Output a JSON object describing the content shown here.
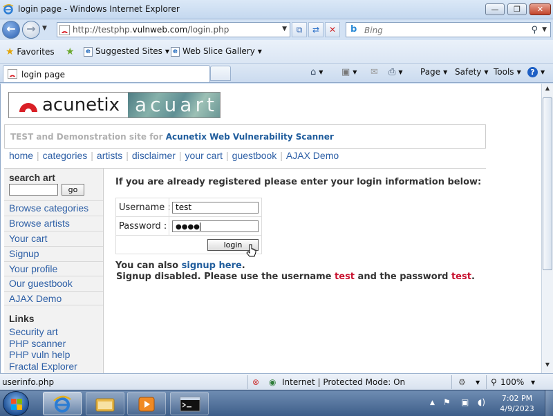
{
  "window": {
    "title": "login page - Windows Internet Explorer",
    "minimize": "—",
    "restore": "❐",
    "close": "✕"
  },
  "address_bar": {
    "url_prefix": "http://testphp.",
    "url_domain": "vulnweb.com",
    "url_path": "/login.php",
    "search_placeholder": "Bing"
  },
  "favorites_bar": {
    "favorites": "Favorites",
    "suggested_sites": "Suggested Sites",
    "web_slice_gallery": "Web Slice Gallery"
  },
  "tabs": {
    "active_tab": "login page",
    "page_menu": "Page",
    "safety_menu": "Safety",
    "tools_menu": "Tools",
    "help": "?"
  },
  "site": {
    "logo_text": "acunetix",
    "logo_art": "acuart",
    "tagline_prefix": "TEST and Demonstration site for ",
    "tagline_link": "Acunetix Web Vulnerability Scanner",
    "top_nav": [
      "home",
      "categories",
      "artists",
      "disclaimer",
      "your cart",
      "guestbook",
      "AJAX Demo"
    ]
  },
  "sidebar": {
    "search_heading": "search art",
    "search_button": "go",
    "nav": [
      "Browse categories",
      "Browse artists",
      "Your cart",
      "Signup",
      "Your profile",
      "Our guestbook",
      "AJAX Demo"
    ],
    "links_heading": "Links",
    "links": [
      "Security art",
      "PHP scanner",
      "PHP vuln help",
      "Fractal Explorer"
    ]
  },
  "login": {
    "intro": "If you are already registered please enter your login information below:",
    "username_label": "Username :",
    "username_value": "test",
    "password_label": "Password :",
    "password_mask": "●●●●",
    "login_button": "login",
    "signup_prefix": "You can also ",
    "signup_link": "signup here",
    "signup_suffix": ".",
    "disabled_prefix": "Signup disabled. Please use the username ",
    "disabled_user": "test",
    "disabled_middle": " and the password ",
    "disabled_pass": "test",
    "disabled_suffix": "."
  },
  "status_bar": {
    "left_text": "userinfo.php",
    "zone": "Internet | Protected Mode: On",
    "zoom": "100%"
  },
  "taskbar": {
    "time": "7:02 PM",
    "date": "4/9/2023"
  },
  "colors": {
    "link_blue": "#2d5fa6",
    "tagline_link": "#1f5c9c",
    "credential_red": "#c8102e",
    "acunetix_red": "#d91f26"
  }
}
